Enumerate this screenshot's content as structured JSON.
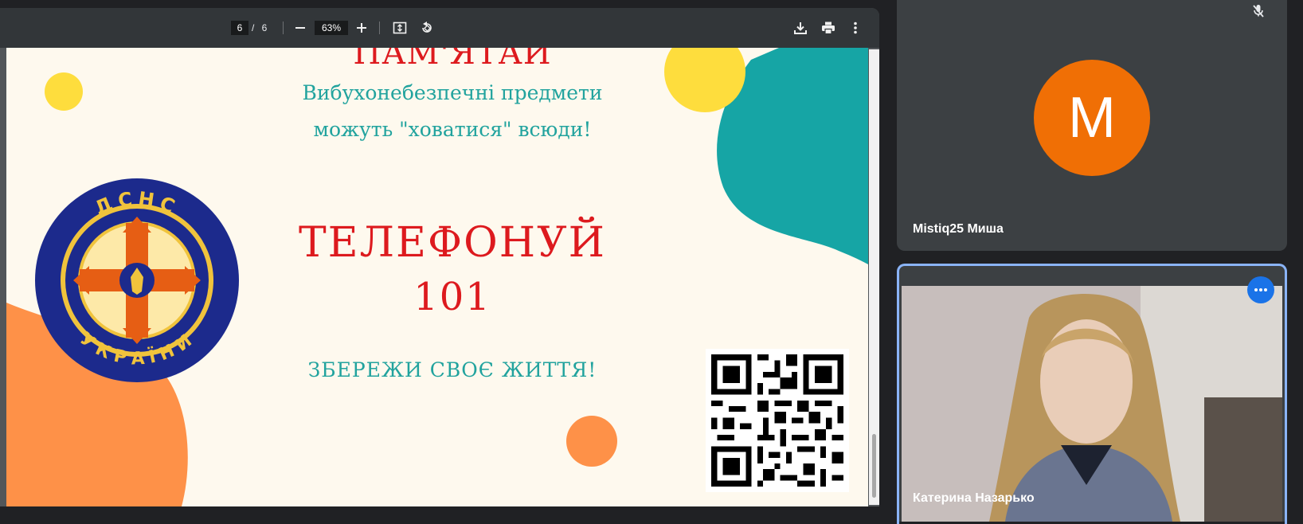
{
  "pdf_viewer": {
    "current_page": "6",
    "page_separator": "/",
    "total_pages": "6",
    "zoom": "63%"
  },
  "slide": {
    "title": "ПАМ'ЯТАЙ",
    "subtitle_line1": "Вибухонебезпечні предмети",
    "subtitle_line2": "можуть \"ховатися\" всюди!",
    "call_text": "ТЕЛЕФОНУЙ",
    "phone_number": "101",
    "save_text": "ЗБЕРЕЖИ СВОЄ ЖИТТЯ!",
    "emblem_top": "ДСНС",
    "emblem_bottom": "УКРАЇНИ"
  },
  "participants": [
    {
      "name": "Mistiq25 Миша",
      "avatar_letter": "M",
      "avatar_color": "#f06f05",
      "muted": true
    },
    {
      "name": "Катерина Назарько",
      "speaking": true
    }
  ],
  "colors": {
    "accent_blue": "#1a73e8",
    "slide_red": "#dd1a1e",
    "slide_teal": "#21a39e",
    "slide_yellow": "#fedd3d",
    "slide_orange": "#fe9148"
  }
}
